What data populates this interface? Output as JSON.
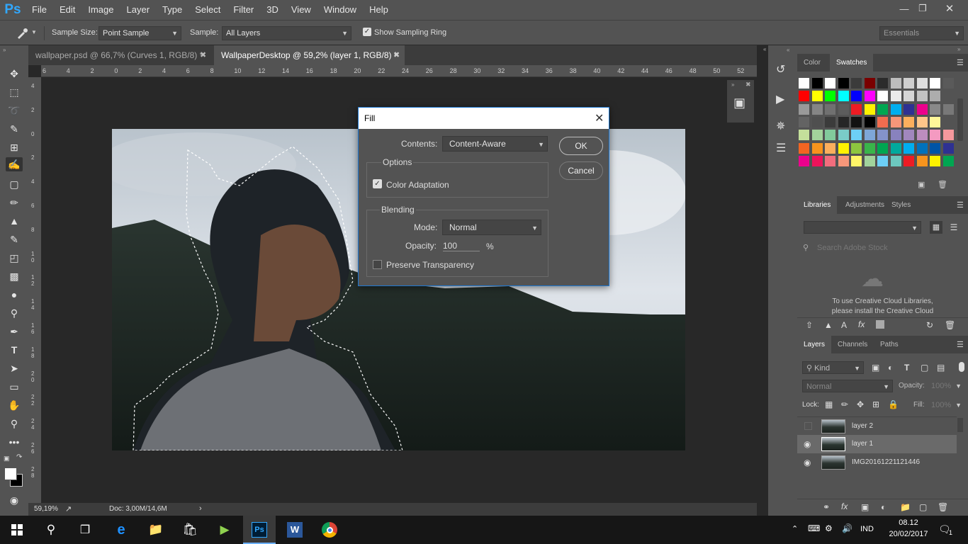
{
  "menubar": {
    "logo": "Ps",
    "items": [
      "File",
      "Edit",
      "Image",
      "Layer",
      "Type",
      "Select",
      "Filter",
      "3D",
      "View",
      "Window",
      "Help"
    ]
  },
  "options": {
    "sample_size_label": "Sample Size:",
    "sample_size_value": "Point Sample",
    "sample_label": "Sample:",
    "sample_value": "All Layers",
    "sampling_ring_label": "Show Sampling Ring",
    "workspace": "Essentials"
  },
  "tabs": [
    {
      "label": "wallpaper.psd @ 66,7% (Curves 1, RGB/8) *",
      "active": false
    },
    {
      "label": "WallpaperDesktop @ 59,2% (layer 1, RGB/8) *",
      "active": true
    }
  ],
  "ruler_h": [
    "6",
    "4",
    "2",
    "0",
    "2",
    "4",
    "6",
    "8",
    "10",
    "12",
    "14",
    "16",
    "18",
    "20",
    "22",
    "24",
    "26",
    "28",
    "30",
    "32",
    "34",
    "36",
    "38",
    "40",
    "42",
    "44",
    "46",
    "48",
    "50",
    "52"
  ],
  "ruler_v": [
    "4",
    "2",
    "0",
    "2",
    "4",
    "6",
    "8",
    "10",
    "12",
    "14",
    "16",
    "18",
    "20",
    "22",
    "24",
    "26",
    "28"
  ],
  "status": {
    "zoom": "59,19%",
    "doc": "Doc: 3,00M/14,6M"
  },
  "fill_dialog": {
    "title": "Fill",
    "contents_label": "Contents:",
    "contents_value": "Content-Aware",
    "options_label": "Options",
    "color_adaptation": "Color Adaptation",
    "blending_label": "Blending",
    "mode_label": "Mode:",
    "mode_value": "Normal",
    "opacity_label": "Opacity:",
    "opacity_value": "100",
    "opacity_unit": "%",
    "preserve_label": "Preserve Transparency",
    "ok": "OK",
    "cancel": "Cancel"
  },
  "color_panel": {
    "tabs": [
      "Color",
      "Swatches"
    ]
  },
  "libraries_panel": {
    "tabs": [
      "Libraries",
      "Adjustments",
      "Styles"
    ],
    "search_placeholder": "Search Adobe Stock",
    "message_1": "To use Creative Cloud Libraries,",
    "message_2": "please install the Creative Cloud"
  },
  "layers_panel": {
    "tabs": [
      "Layers",
      "Channels",
      "Paths"
    ],
    "kind": "Kind",
    "blend": "Normal",
    "opacity_label": "Opacity:",
    "opacity": "100%",
    "lock_label": "Lock:",
    "fill_label": "Fill:",
    "fill": "100%",
    "layers": [
      {
        "name": "layer 2",
        "visible": false,
        "selected": false
      },
      {
        "name": "layer 1",
        "visible": true,
        "selected": true
      },
      {
        "name": "IMG20161221121446",
        "visible": true,
        "selected": false
      }
    ]
  },
  "taskbar": {
    "lang": "IND",
    "time": "08.12",
    "date": "20/02/2017",
    "notifications": "1"
  },
  "swatch_colors": [
    [
      "#ffffff",
      "#000000",
      "#ffffff",
      "#000000",
      "#3b3b3b",
      "#7a0000",
      "#2b2b2b",
      "#bdbdbd",
      "#cfcfcf",
      "#dfdfdf",
      "#ffffff",
      "#5a5a5a",
      "#00aaff"
    ],
    [
      "#ff0000",
      "#ffff00",
      "#00ff00",
      "#00ffff",
      "#0000ff",
      "#ff00ff",
      "#ffffff",
      "#ebebeb",
      "#d6d6d6",
      "#c2c2c2",
      "#adadad"
    ],
    [
      "#999999",
      "#858585",
      "#707070",
      "#5c5c5c",
      "#ed1c24",
      "#fff200",
      "#00a651",
      "#00aeef",
      "#2e3192",
      "#ec008c",
      "#898989",
      "#787878"
    ],
    [
      "#636363",
      "#4f4f4f",
      "#3b3b3b",
      "#262626",
      "#121212",
      "#000000",
      "#f26c4f",
      "#f69679",
      "#fbaf5d",
      "#fdc68a",
      "#fff799"
    ],
    [
      "#c4df9b",
      "#a3d39c",
      "#82ca9c",
      "#7accc8",
      "#6dcff6",
      "#7ea7d8",
      "#8493ca",
      "#8882be",
      "#a187be",
      "#bc8dbf",
      "#f49ac1",
      "#f5989d"
    ],
    [
      "#f26522",
      "#f7941d",
      "#fbaf5d",
      "#fff200",
      "#8dc63f",
      "#39b54a",
      "#00a651",
      "#00a99d",
      "#00aeef",
      "#0072bc",
      "#0054a6",
      "#2e3192"
    ],
    [
      "#ec008c",
      "#ed145b",
      "#f26d7d",
      "#f7977a",
      "#fff568",
      "#a2d39c",
      "#6dcff6",
      "#6dc8bf",
      "#ed1c24",
      "#f7941d",
      "#fff200",
      "#00a651",
      "#00aeef"
    ]
  ]
}
